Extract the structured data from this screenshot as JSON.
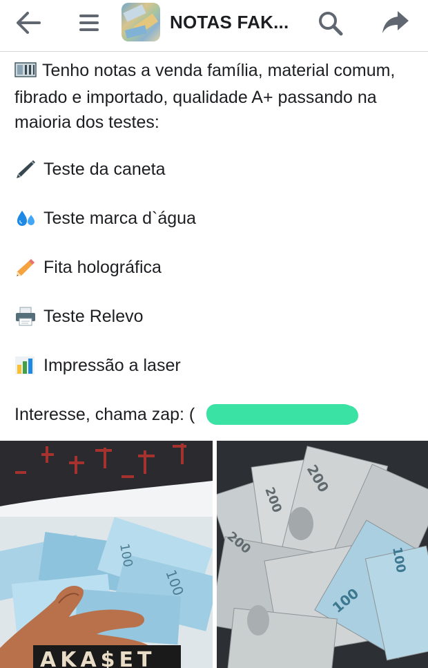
{
  "header": {
    "back_icon": "arrow-left-icon",
    "menu_icon": "hamburger-menu-icon",
    "group_title": "NOTAS FAK...",
    "search_icon": "search-icon",
    "share_icon": "share-arrow-icon"
  },
  "post": {
    "intro_icon": "banknote-icon",
    "intro_text": "Tenho notas a venda família, material comum, fibrado e importado, qualidade A+ passando na maioria dos testes:",
    "items": [
      {
        "icon": "pen-icon",
        "label": "Teste da caneta"
      },
      {
        "icon": "droplets-icon",
        "label": "Teste marca d`água"
      },
      {
        "icon": "pencil-icon",
        "label": "Fita holográfica"
      },
      {
        "icon": "printer-icon",
        "label": "Teste Relevo"
      },
      {
        "icon": "bar-chart-icon",
        "label": "Impressão a laser"
      }
    ],
    "contact_prefix": "Interesse, chama zap: ("
  },
  "photos": {
    "left": {
      "watermark": "AKA$ET"
    },
    "right": {}
  },
  "colors": {
    "text": "#1c1e21",
    "icon_gray": "#606770",
    "redaction": "#3ae2a4",
    "header_border": "#d4d6da"
  }
}
